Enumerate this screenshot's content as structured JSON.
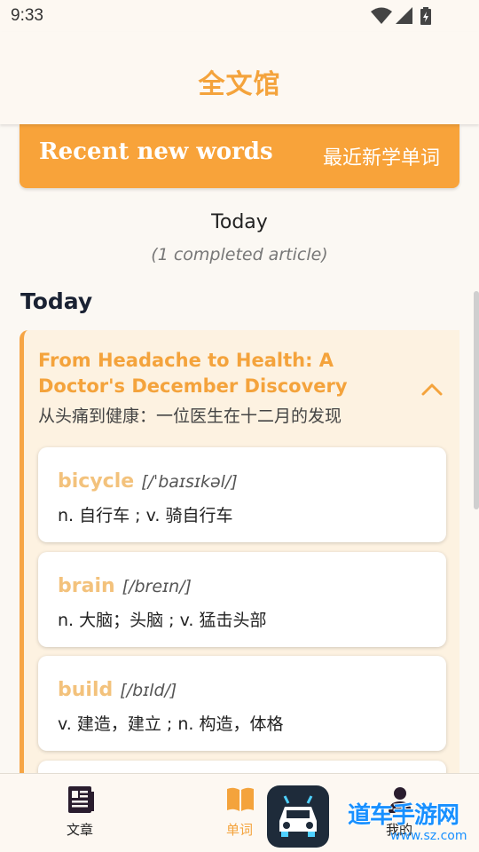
{
  "status_bar": {
    "time": "9:33",
    "icons": [
      "wifi-icon",
      "signal-icon",
      "battery-icon"
    ]
  },
  "header": {
    "title": "全文馆"
  },
  "banner": {
    "title": "Recent new words",
    "subtitle": "最近新学单词"
  },
  "summary": {
    "date": "Today",
    "count": "(1 completed article)"
  },
  "section": {
    "heading": "Today"
  },
  "article": {
    "title": "From Headache to Health: A Doctor's December Discovery",
    "subtitle": "从头痛到健康：一位医生在十二月的发现",
    "expanded": true,
    "words": [
      {
        "term": "bicycle",
        "phonetic": "[/ˈbaɪsɪkəl/]",
        "definition": "n. 自行车 ; v. 骑自行车"
      },
      {
        "term": "brain",
        "phonetic": "[/breɪn/]",
        "definition": "n. 大脑；头脑 ; v. 猛击头部"
      },
      {
        "term": "build",
        "phonetic": "[/bɪld/]",
        "definition": "v. 建造，建立 ; n. 构造，体格"
      }
    ]
  },
  "bottom_nav": {
    "items": [
      {
        "label": "文章",
        "icon": "article-icon",
        "active": false
      },
      {
        "label": "单词",
        "icon": "book-icon",
        "active": true
      },
      {
        "label": "我的",
        "icon": "profile-icon",
        "active": false
      }
    ]
  },
  "overlay": {
    "watermark": "道车手游网",
    "watermark_url": "www.sz.com"
  },
  "colors": {
    "accent": "#f4a33c",
    "banner": "#f8a33a",
    "card_bg": "#fdf2e1",
    "word_term": "#f3c27c",
    "background": "#fbf8f3"
  }
}
